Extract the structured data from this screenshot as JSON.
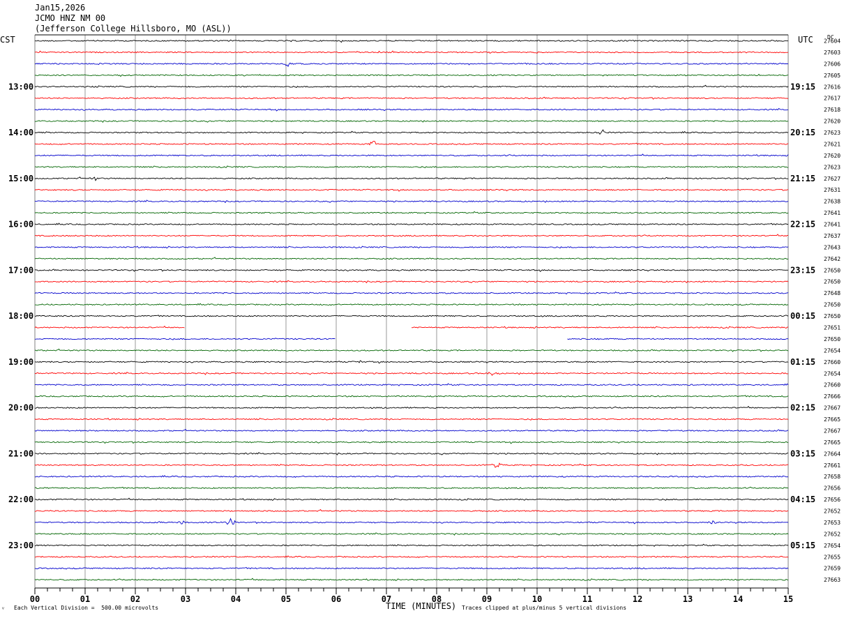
{
  "header": {
    "date": "Jan15,2026",
    "channel": "JCMO HNZ NM 00",
    "station": "(Jefferson College Hillsboro, MO (ASL))"
  },
  "left_tz": "CST",
  "right_tz": "UTC",
  "dc_label": "DC",
  "footer": {
    "scale": "Each Vertical Division =  500.00 microvolts",
    "xlabel": "TIME (MINUTES)",
    "clip_note": "Traces clipped at plus/minus 5 vertical divisions",
    "mark": "ⱽ"
  },
  "colors": {
    "trace_cycle": [
      "#000000",
      "#ff0000",
      "#0000cc",
      "#006400"
    ],
    "grid": "#808080"
  },
  "chart_data": {
    "type": "line",
    "title": "JCMO HNZ NM 00",
    "xlabel": "TIME (MINUTES)",
    "xlim": [
      0,
      15
    ],
    "x_ticks": [
      "00",
      "01",
      "02",
      "03",
      "04",
      "05",
      "06",
      "07",
      "08",
      "09",
      "10",
      "11",
      "12",
      "13",
      "14",
      "15"
    ],
    "left_hour_labels": [
      "13:00",
      "14:00",
      "15:00",
      "16:00",
      "17:00",
      "18:00",
      "19:00",
      "20:00",
      "21:00",
      "22:00",
      "23:00"
    ],
    "right_hour_labels": [
      "19:15",
      "20:15",
      "21:15",
      "22:15",
      "23:15",
      "00:15",
      "01:15",
      "02:15",
      "03:15",
      "04:15",
      "05:15"
    ],
    "dc_offsets": [
      27604,
      27603,
      27606,
      27605,
      27616,
      27617,
      27618,
      27620,
      27623,
      27621,
      27620,
      27623,
      27627,
      27631,
      27638,
      27641,
      27641,
      27637,
      27643,
      27642,
      27650,
      27650,
      27648,
      27650,
      27650,
      27651,
      27650,
      27654,
      27660,
      27654,
      27660,
      27666,
      27667,
      27665,
      27667,
      27665,
      27664,
      27661,
      27658,
      27656,
      27656,
      27652,
      27653,
      27652,
      27654,
      27655,
      27659,
      27663
    ],
    "trace_count": 48,
    "events": [
      {
        "trace": 2,
        "minute": 5.0,
        "amp": 5
      },
      {
        "trace": 8,
        "minute": 11.3,
        "amp": 4
      },
      {
        "trace": 9,
        "minute": 6.75,
        "amp": 5
      },
      {
        "trace": 12,
        "minute": 1.2,
        "amp": 3
      },
      {
        "trace": 42,
        "minute": 3.9,
        "amp": 5
      },
      {
        "trace": 42,
        "minute": 2.9,
        "amp": 4
      },
      {
        "trace": 42,
        "minute": 13.5,
        "amp": 3
      },
      {
        "trace": 37,
        "minute": 9.2,
        "amp": 5
      },
      {
        "trace": 28,
        "minute": 6.5,
        "amp": 3
      },
      {
        "trace": 29,
        "minute": 9.1,
        "amp": 3
      },
      {
        "trace": 31,
        "minute": 15.0,
        "amp": 4
      }
    ],
    "gaps": [
      {
        "trace": 25,
        "start_minute": 3.0,
        "end_minute": 7.5
      },
      {
        "trace": 26,
        "start_minute": 6.0,
        "end_minute": 10.6
      }
    ],
    "grid": true
  }
}
